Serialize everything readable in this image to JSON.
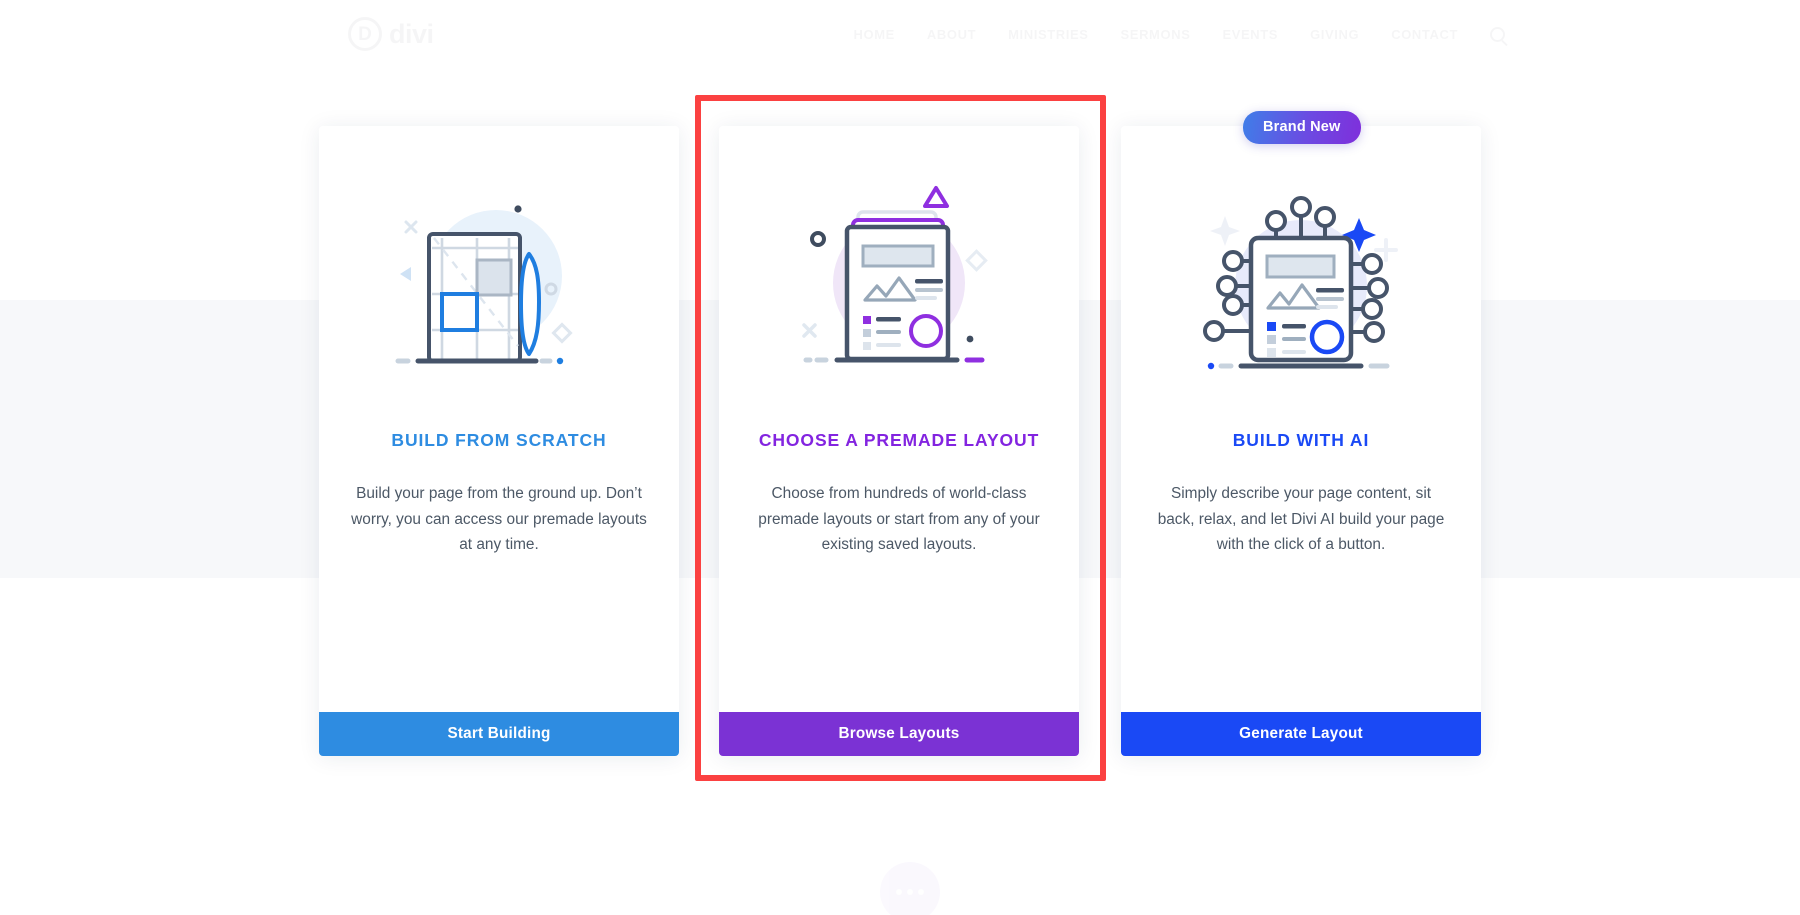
{
  "background_page": {
    "logo_mark": "D",
    "logo_text": "divi",
    "nav_items": [
      "HOME",
      "ABOUT",
      "MINISTRIES",
      "SERMONS",
      "EVENTS",
      "GIVING",
      "CONTACT"
    ],
    "search_icon": "search-icon",
    "floating_menu_icon": "ellipsis-icon"
  },
  "overlay": {
    "badge": {
      "label": "Brand New"
    },
    "highlight": {
      "color": "#fb4141",
      "target": "premade-layout-card"
    },
    "cards": [
      {
        "id": "build-from-scratch",
        "title": "BUILD FROM SCRATCH",
        "description": "Build your page from the ground up. Don’t worry, you can access our premade layouts at any time.",
        "cta": "Start Building",
        "accent": "#2e8ce1",
        "illustration": "blueprint-page-with-pencil-icon"
      },
      {
        "id": "choose-premade-layout",
        "title": "CHOOSE A PREMADE LAYOUT",
        "description": "Choose from hundreds of world-class premade layouts or start from any of your existing saved layouts.",
        "cta": "Browse Layouts",
        "accent": "#8324e0",
        "illustration": "stacked-layout-page-icon"
      },
      {
        "id": "build-with-ai",
        "title": "BUILD WITH AI",
        "description": "Simply describe your page content, sit back, relax, and let Divi AI build your page with the click of a button.",
        "cta": "Generate Layout",
        "accent": "#1a49f5",
        "illustration": "ai-chip-page-icon"
      }
    ]
  }
}
